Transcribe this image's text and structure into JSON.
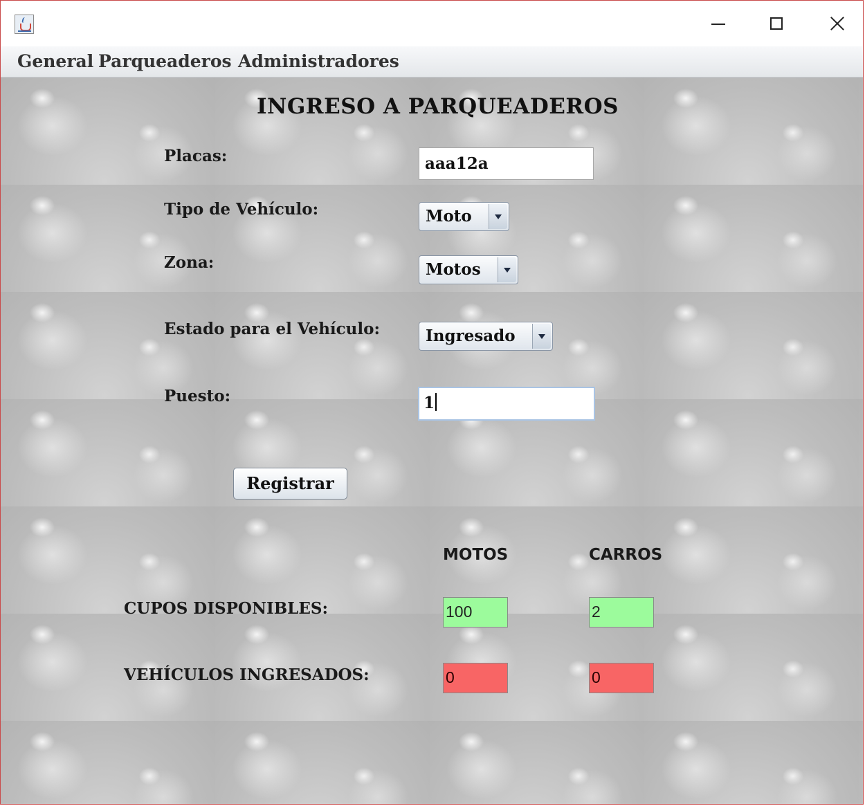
{
  "window": {
    "title": "",
    "icon": "java-cup-icon",
    "controls": [
      "minimize-icon",
      "maximize-icon",
      "close-icon"
    ]
  },
  "menu": {
    "items": [
      "General",
      "Parqueaderos",
      "Administradores"
    ]
  },
  "form": {
    "title": "INGRESO A PARQUEADEROS",
    "placas_label": "Placas:",
    "placas_value": "aaa12a",
    "tipo_label": "Tipo de Vehículo:",
    "tipo_value": "Moto",
    "zona_label": "Zona:",
    "zona_value": "Motos",
    "estado_label": "Estado para el Vehículo:",
    "estado_value": "Ingresado",
    "puesto_label": "Puesto:",
    "puesto_value": "1",
    "register_label": "Registrar"
  },
  "stats": {
    "col_motos": "MOTOS",
    "col_carros": "CARROS",
    "cupos_label": "CUPOS DISPONIBLES:",
    "ingresados_label": "VEHÍCULOS INGRESADOS:",
    "cupos_motos": "100",
    "cupos_carros": "2",
    "ingresados_motos": "0",
    "ingresados_carros": "0"
  },
  "colors": {
    "available": "#9cfb9c",
    "occupied": "#f86565",
    "window_border": "#c94a4a"
  }
}
